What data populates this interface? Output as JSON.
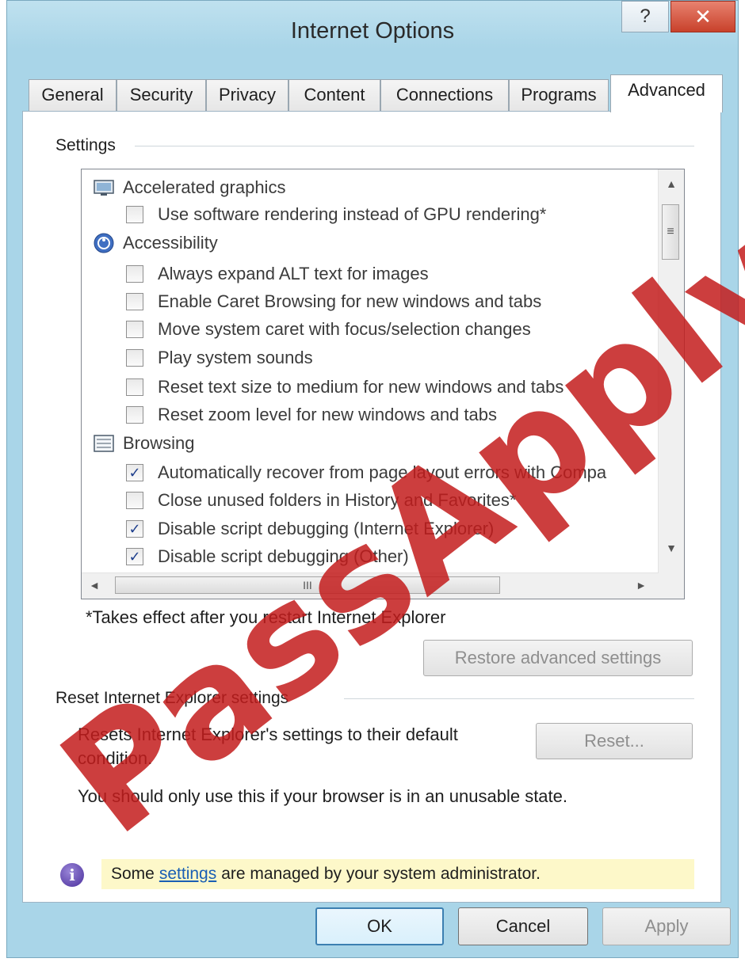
{
  "window": {
    "title": "Internet Options",
    "help_glyph": "?",
    "close_glyph": "✕"
  },
  "tabs": [
    {
      "label": "General"
    },
    {
      "label": "Security"
    },
    {
      "label": "Privacy"
    },
    {
      "label": "Content"
    },
    {
      "label": "Connections"
    },
    {
      "label": "Programs"
    },
    {
      "label": "Advanced",
      "active": true
    }
  ],
  "settings": {
    "group_label": "Settings",
    "tree": [
      {
        "type": "category",
        "icon": "monitor-icon",
        "label": "Accelerated graphics"
      },
      {
        "type": "option",
        "checked": false,
        "label": "Use software rendering instead of GPU rendering*"
      },
      {
        "type": "category",
        "icon": "accessibility-icon",
        "label": "Accessibility"
      },
      {
        "type": "option",
        "checked": false,
        "label": "Always expand ALT text for images"
      },
      {
        "type": "option",
        "checked": false,
        "label": "Enable Caret Browsing for new windows and tabs"
      },
      {
        "type": "option",
        "checked": false,
        "label": "Move system caret with focus/selection changes"
      },
      {
        "type": "option",
        "checked": false,
        "label": "Play system sounds"
      },
      {
        "type": "option",
        "checked": false,
        "label": "Reset text size to medium for new windows and tabs"
      },
      {
        "type": "option",
        "checked": false,
        "label": "Reset zoom level for new windows and tabs"
      },
      {
        "type": "category",
        "icon": "browsing-icon",
        "label": "Browsing"
      },
      {
        "type": "option",
        "checked": true,
        "label": "Automatically recover from page layout errors with Compa"
      },
      {
        "type": "option",
        "checked": false,
        "label": "Close unused folders in History and Favorites*"
      },
      {
        "type": "option",
        "checked": true,
        "label": "Disable script debugging (Internet Explorer)"
      },
      {
        "type": "option",
        "checked": true,
        "label": "Disable script debugging (Other)"
      }
    ],
    "scroll_up": "▲",
    "scroll_down": "▼",
    "scroll_left": "◄",
    "scroll_right": "►",
    "vthumb_grip": "≡",
    "hthumb_grip": "III",
    "note": "*Takes effect after you restart Internet Explorer",
    "restore_button": "Restore advanced settings"
  },
  "reset": {
    "group_label": "Reset Internet Explorer settings",
    "description_line1": "Resets Internet Explorer's settings to their default",
    "description_line2": "condition.",
    "reset_button": "Reset...",
    "warning": "You should only use this if your browser is in an unusable state."
  },
  "notice": {
    "before": "Some",
    "link": "settings",
    "after": "are managed by your system administrator.",
    "icon_glyph": "i"
  },
  "footer": {
    "ok": "OK",
    "cancel": "Cancel",
    "apply": "Apply"
  },
  "watermark": "PassApply.co"
}
